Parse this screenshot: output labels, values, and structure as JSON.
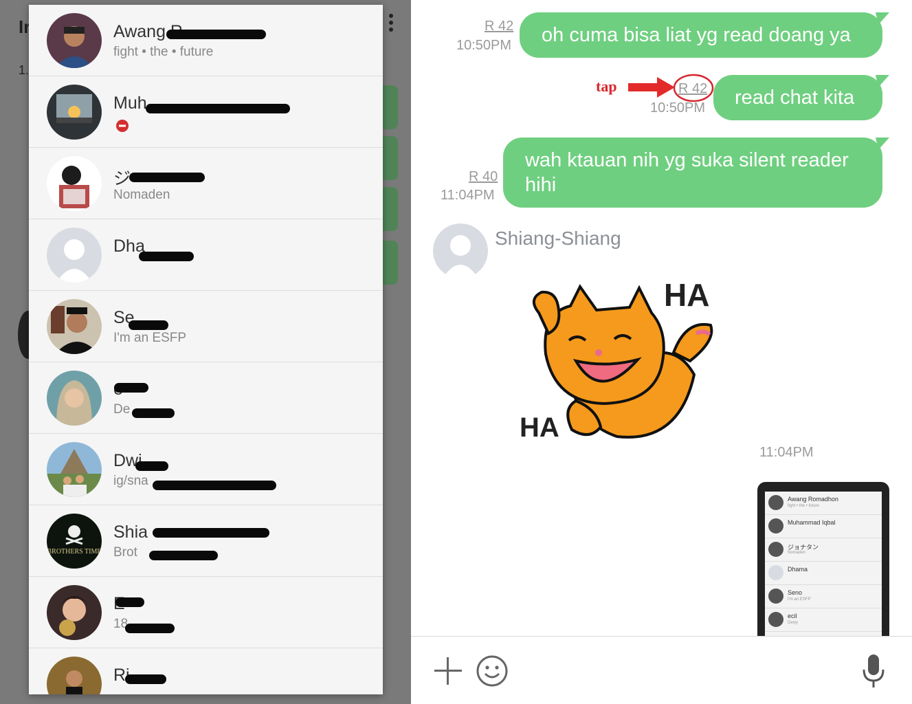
{
  "background_app": {
    "fragments": [
      "In",
      "1."
    ]
  },
  "contacts": [
    {
      "name": "Awang R",
      "status": "fight • the • future",
      "blocked": false
    },
    {
      "name": "Muh",
      "status": "",
      "blocked": true
    },
    {
      "name": "ジ",
      "status": "Nomaden",
      "blocked": false
    },
    {
      "name": "Dha",
      "status": "",
      "blocked": false
    },
    {
      "name": "Se",
      "status": "I'm an ESFP",
      "blocked": false
    },
    {
      "name": "e",
      "status": "De",
      "blocked": false
    },
    {
      "name": "Dwi",
      "status": "ig/sna",
      "blocked": false
    },
    {
      "name": "Shia",
      "status": "Brot",
      "blocked": false
    },
    {
      "name": "E",
      "status": "18",
      "blocked": false
    },
    {
      "name": "Ri",
      "status": "",
      "blocked": false
    }
  ],
  "avatar_logo_text": "BROTHERS TIME",
  "chat": {
    "messages": [
      {
        "text": "oh cuma bisa liat yg read doang ya",
        "read": "R 42",
        "time": "10:50PM"
      },
      {
        "text": "read chat kita",
        "read": "R 42",
        "time": "10:50PM"
      },
      {
        "text_line1": "wah ktauan nih yg suka silent reader",
        "text_line2": "hihi",
        "read": "R 40",
        "time": "11:04PM"
      }
    ],
    "incoming": {
      "sender": "Shiang-Shiang",
      "sticker_text_1": "HA",
      "sticker_text_2": "HA",
      "time": "11:04PM"
    },
    "annotation": {
      "label": "tap",
      "color": "#d7262e"
    },
    "thumbnail_rows": [
      {
        "name": "Awang Romadhon",
        "status": "fight • the • future"
      },
      {
        "name": "Muhammad Iqbal",
        "status": ""
      },
      {
        "name": "ジョナタン",
        "status": "Nomaden"
      },
      {
        "name": "Dhama",
        "status": ""
      },
      {
        "name": "Seno",
        "status": "I'm an ESFP"
      },
      {
        "name": "ecil",
        "status": "Dewy"
      }
    ]
  },
  "composer": {
    "icons": [
      "plus-icon",
      "emoji-icon",
      "microphone-icon"
    ]
  },
  "colors": {
    "bubble_green": "#6fcf80",
    "overlay_gray": "#7a7a7a",
    "annotation_red": "#d7262e"
  }
}
